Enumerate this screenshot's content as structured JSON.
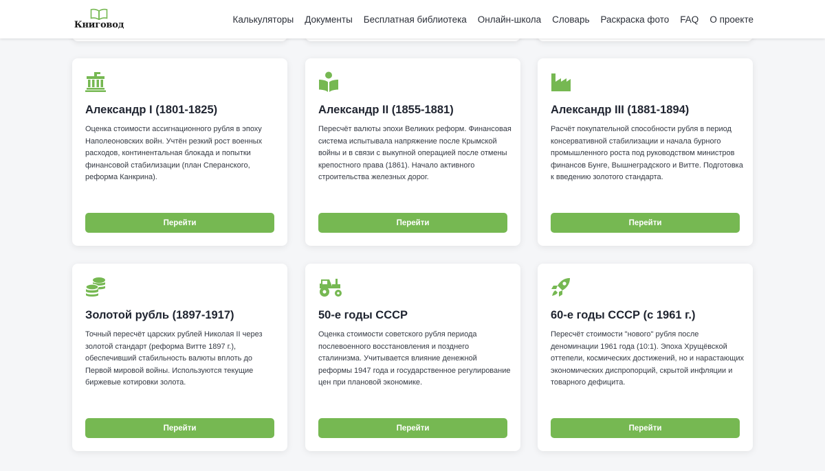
{
  "header": {
    "logo_text": "Книговод",
    "nav": [
      "Калькуляторы",
      "Документы",
      "Бесплатная библиотека",
      "Онлайн-школа",
      "Словарь",
      "Раскраска фото",
      "FAQ",
      "О проекте"
    ]
  },
  "colors": {
    "accent": "#76b852",
    "background": "#f5f6f8"
  },
  "cards": [
    {
      "icon": "institution-icon",
      "title": "Александр I (1801-1825)",
      "description": "Оценка стоимости ассигнационного рубля в эпоху Наполеоновских войн. Учтён резкий рост военных расходов, континентальная блокада и попытки финансовой стабилизации (план Сперанского, реформа Канкрина).",
      "button": "Перейти"
    },
    {
      "icon": "book-reader-icon",
      "title": "Александр II (1855-1881)",
      "description": "Пересчёт валюты эпохи Великих реформ. Финансовая система испытывала напряжение после Крымской войны и в связи с выкупной операцией после отмены крепостного права (1861). Начало активного строительства железных дорог.",
      "button": "Перейти"
    },
    {
      "icon": "industry-icon",
      "title": "Александр III (1881-1894)",
      "description": "Расчёт покупательной способности рубля в период консервативной стабилизации и начала бурного промышленного роста под руководством министров финансов Бунге, Вышнеградского и Витте. Подготовка к введению золотого стандарта.",
      "button": "Перейти"
    },
    {
      "icon": "coins-icon",
      "title": "Золотой рубль (1897-1917)",
      "description": "Точный пересчёт царских рублей Николая II через золотой стандарт (реформа Витте 1897 г.), обеспечивший стабильность валюты вплоть до Первой мировой войны. Используются текущие биржевые котировки золота.",
      "button": "Перейти"
    },
    {
      "icon": "tractor-icon",
      "title": "50-е годы СССР",
      "description": "Оценка стоимости советского рубля периода послевоенного восстановления и позднего сталинизма. Учитывается влияние денежной реформы 1947 года и государственное регулирование цен при плановой экономике.",
      "button": "Перейти"
    },
    {
      "icon": "rocket-icon",
      "title": "60-е годы СССР (с 1961 г.)",
      "description": "Пересчёт стоимости \"нового\" рубля после деноминации 1961 года (10:1). Эпоха Хрущёвской оттепели, космических достижений, но и нарастающих экономических диспропорций, скрытой инфляции и товарного дефицита.",
      "button": "Перейти"
    }
  ]
}
